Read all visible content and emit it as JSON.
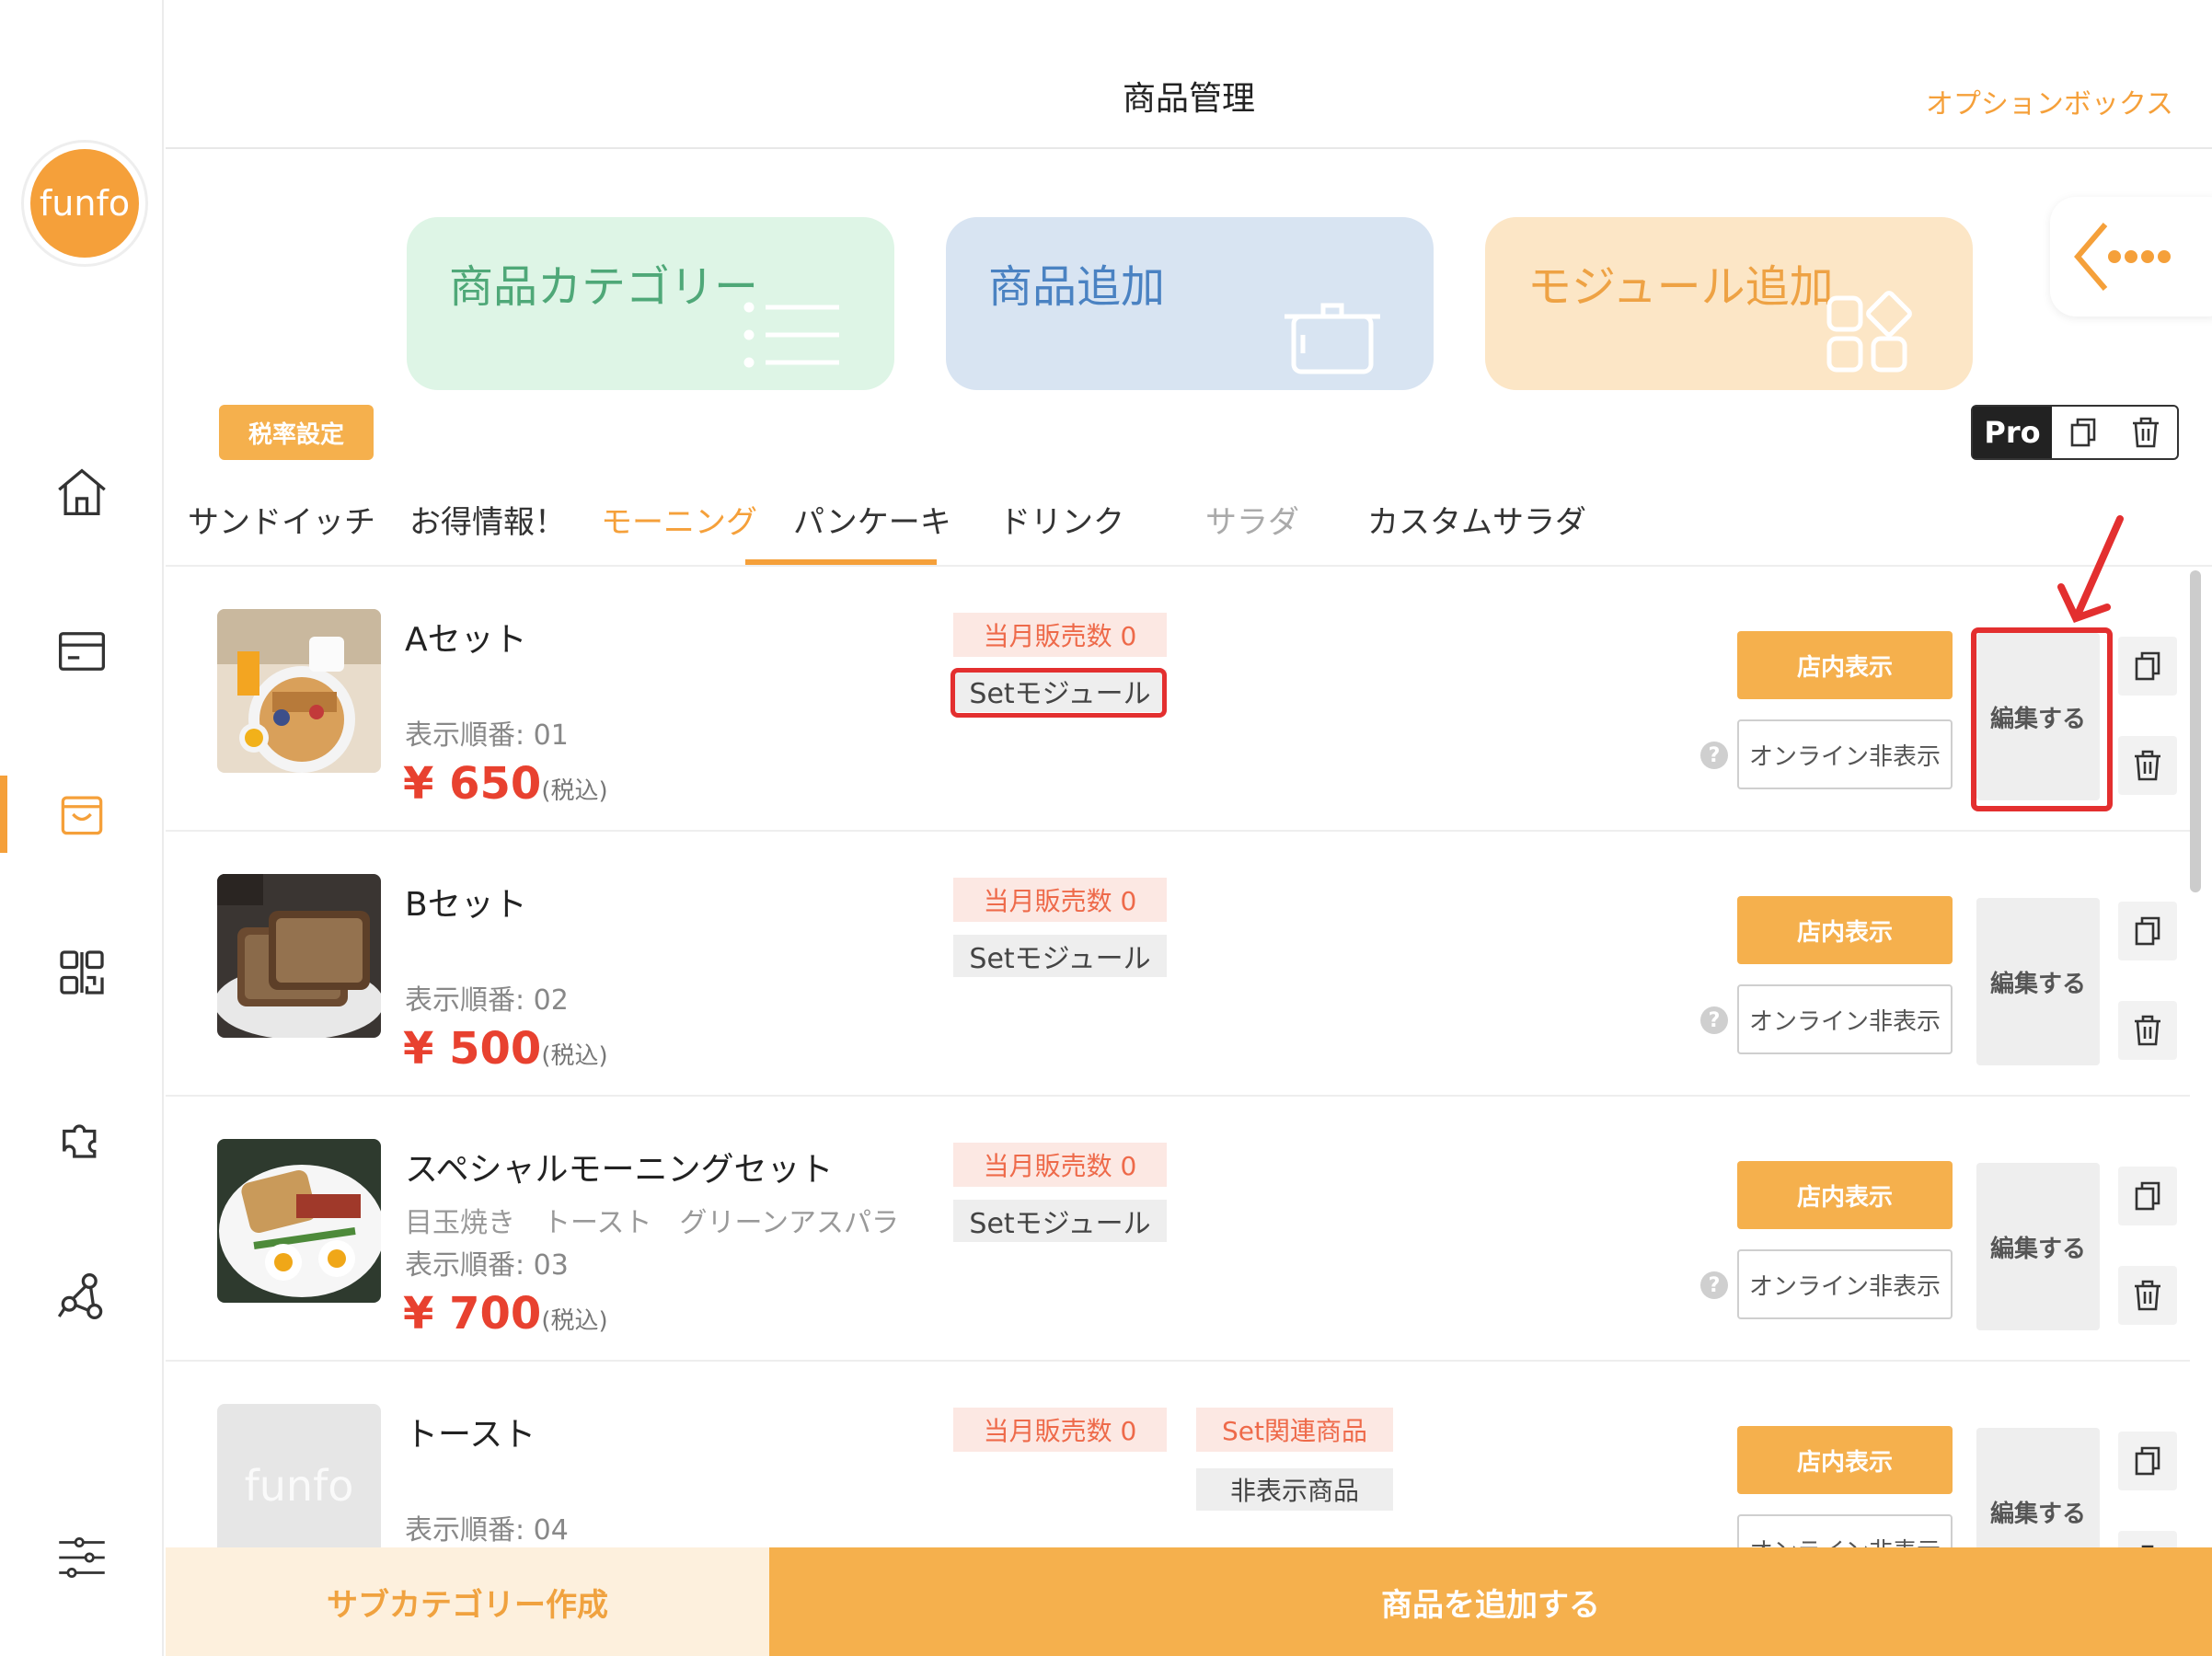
{
  "header": {
    "title": "商品管理",
    "option_box": "オプションボックス"
  },
  "logo": {
    "text": "funfo"
  },
  "sidebar": {
    "items": [
      {
        "icon": "home-icon"
      },
      {
        "icon": "card-icon"
      },
      {
        "icon": "bag-icon",
        "active": true
      },
      {
        "icon": "qr-code-icon"
      },
      {
        "icon": "puzzle-icon"
      },
      {
        "icon": "network-icon"
      },
      {
        "icon": "settings-sliders-icon"
      }
    ]
  },
  "cards": {
    "category": "商品カテゴリー",
    "add": "商品追加",
    "module": "モジュール追加"
  },
  "toolbar": {
    "tax": "税率設定",
    "pro": "Pro"
  },
  "tabs": [
    {
      "label": "サンドイッチ"
    },
    {
      "label": "お得情報！"
    },
    {
      "label": "モーニング",
      "active": true
    },
    {
      "label": "パンケーキ"
    },
    {
      "label": "ドリンク"
    },
    {
      "label": "サラダ",
      "muted": true
    },
    {
      "label": "カスタムサラダ"
    }
  ],
  "products": [
    {
      "name": "Aセット",
      "desc": "",
      "order": "表示順番: 01",
      "price": "¥ 650",
      "tax": "(税込)",
      "sales": "当月販売数 0",
      "module": "Setモジュール",
      "store": "店内表示",
      "online": "オンライン非表示",
      "edit": "編集する"
    },
    {
      "name": "Bセット",
      "desc": "",
      "order": "表示順番: 02",
      "price": "¥ 500",
      "tax": "(税込)",
      "sales": "当月販売数 0",
      "module": "Setモジュール",
      "store": "店内表示",
      "online": "オンライン非表示",
      "edit": "編集する"
    },
    {
      "name": "スペシャルモーニングセット",
      "desc": "目玉焼き　トースト　グリーンアスパラ",
      "order": "表示順番: 03",
      "price": "¥ 700",
      "tax": "(税込)",
      "sales": "当月販売数 0",
      "module": "Setモジュール",
      "store": "店内表示",
      "online": "オンライン非表示",
      "edit": "編集する"
    },
    {
      "name": "トースト",
      "desc": "",
      "order": "表示順番: 04",
      "price": "",
      "tax": "",
      "sales": "当月販売数 0",
      "related": "Set関連商品",
      "hidden": "非表示商品",
      "placeholder": "funfo",
      "store": "店内表示",
      "online": "オンライン非表示",
      "edit": "編集する"
    }
  ],
  "bottom": {
    "subcategory": "サブカテゴリー作成",
    "add_product": "商品を追加する"
  },
  "colors": {
    "accent": "#f5a03a",
    "price": "#e8412f",
    "highlight": "#e32f2f"
  }
}
